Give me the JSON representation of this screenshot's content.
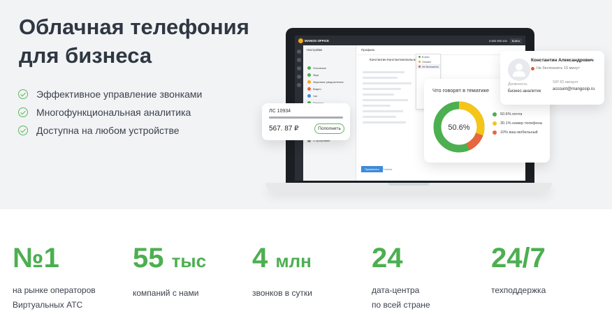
{
  "hero": {
    "title_line1": "Облачная телефония",
    "title_line2": "для бизнеса",
    "features": [
      "Эффективное управление звонками",
      "Многофункциональная аналитика",
      "Доступна на любом устройстве"
    ]
  },
  "app": {
    "brand": "MANGO OFFICE",
    "balance": "8 800 555 434",
    "topbar_button": "Войти",
    "settings_title": "Настройки",
    "profile_title": "Профиль",
    "settings_items": [
      "Основные",
      "Звук",
      "Звуковые уведомления",
      "Видео",
      "Чат",
      "Помощь",
      "Подарки",
      "О программе"
    ],
    "profile_name": "Константин Константинопольский",
    "save_button": "Применить",
    "cancel_button": "Отмена",
    "dropdown_items": [
      "В сети",
      "Отошёл",
      "Не беспокоить"
    ]
  },
  "account_card": {
    "label": "ЛС 10934",
    "balance": "567. 87 ₽",
    "button": "Пополнить"
  },
  "topics_card": {
    "title": "Что говорят в тематике",
    "center": "50.6%",
    "items": [
      {
        "label": "50.6% почта",
        "color": "#4caf50",
        "value": 50.6
      },
      {
        "label": "30.1% номер телефона",
        "color": "#f5c518",
        "value": 30.1
      },
      {
        "label": "10% ваш мобильный",
        "color": "#e8663d",
        "value": 10
      }
    ]
  },
  "user_card": {
    "name": "Константин Александрович",
    "status": "Не беспокоить 15 минут",
    "field1_label": "Должность",
    "field1_value": "Бизнес-аналитик",
    "field2_label": "SIP-ID аккаунт",
    "field2_value": "account@mangosip.ru"
  },
  "stats": [
    {
      "big": "№1",
      "desc1": "на рынке операторов",
      "desc2": "Виртуальных АТС"
    },
    {
      "big": "55",
      "unit": "тыс",
      "desc1": "компаний с нами",
      "desc2": ""
    },
    {
      "big": "4",
      "unit": "млн",
      "desc1": "звонков в сутки",
      "desc2": ""
    },
    {
      "big": "24",
      "desc1": "дата-центра",
      "desc2": "по всей стране"
    },
    {
      "big": "24/7",
      "desc1": "техподдержка",
      "desc2": ""
    }
  ]
}
